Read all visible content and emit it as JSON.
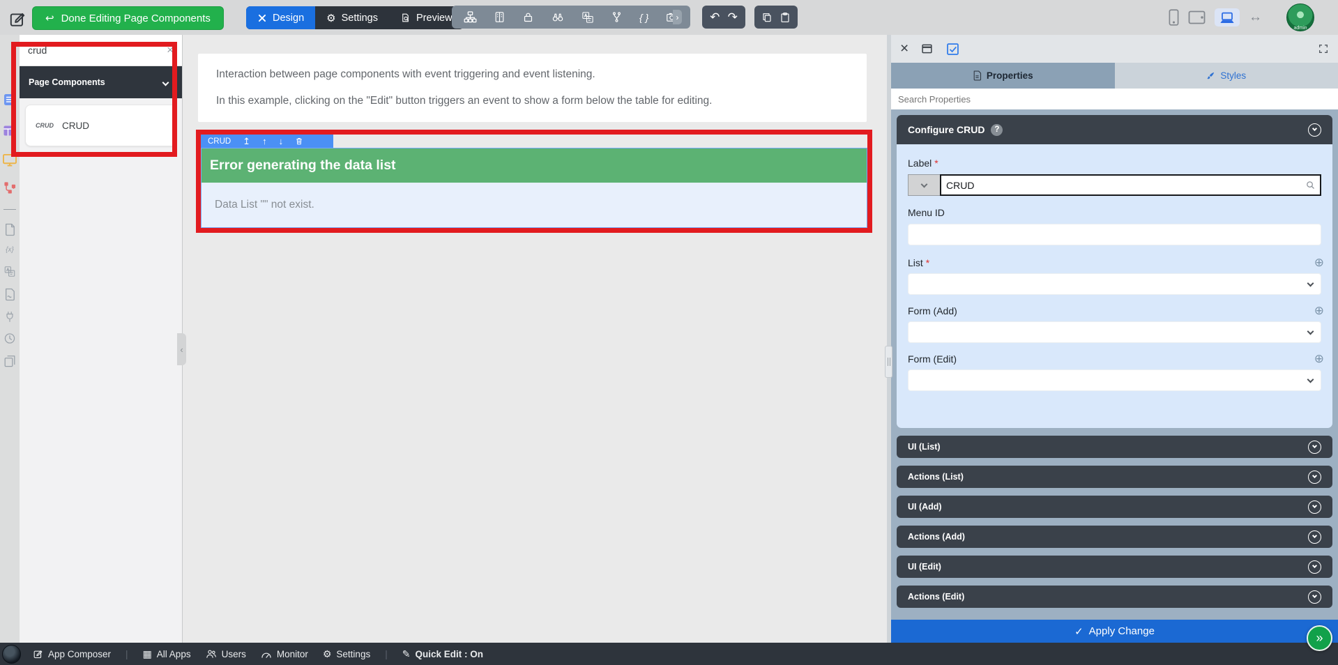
{
  "glyphs": {
    "back_arrow": "↩",
    "undo": "↶",
    "redo": "↷",
    "braces": "{ }",
    "chevron_right": "›",
    "arrows_lr": "↔",
    "gear": "⚙",
    "close": "×",
    "up_from_bar": "↥",
    "arrow_up": "↑",
    "arrow_down": "↓",
    "plus_circle": "⊕",
    "check": "✓",
    "double_right": "»",
    "grid": "▦",
    "pencil": "✎",
    "divider": "|",
    "collapse_left": "‹",
    "question": "?",
    "variable": "{x}"
  },
  "topbar": {
    "done_button_label": "Done Editing Page Components",
    "view_tabs": [
      {
        "label": "Design"
      },
      {
        "label": "Settings"
      },
      {
        "label": "Preview"
      }
    ],
    "tool_icons": [
      "sitemap",
      "form-builder",
      "lock",
      "binoculars",
      "translate",
      "branch",
      "braces",
      "camera"
    ],
    "history_icons": [
      "undo",
      "redo"
    ],
    "clipboard_icons": [
      "copy",
      "paste"
    ],
    "device_icons": [
      "mobile",
      "tablet",
      "desktop",
      "responsive"
    ],
    "avatar_label": "admin"
  },
  "left_strip": {
    "icons": [
      "compose",
      "form-blue",
      "datalist-purple",
      "userview-yellow",
      "process-red",
      "page",
      "variable",
      "translate",
      "script-file",
      "plugin",
      "history",
      "pages"
    ]
  },
  "sidebar": {
    "search_value": "crud",
    "section_label": "Page Components",
    "item": {
      "icon_text": "CRUD",
      "label": "CRUD"
    }
  },
  "canvas": {
    "intro_line1": "Interaction between page components with event triggering and event listening.",
    "intro_line2": "In this example, clicking on the \"Edit\" button triggers an event to show a form below the table for editing.",
    "crud": {
      "tag_label": "CRUD",
      "error_title": "Error generating the data list",
      "error_message": "Data List \"\" not exist."
    }
  },
  "panel": {
    "tabs": [
      {
        "label": "Properties"
      },
      {
        "label": "Styles"
      }
    ],
    "search_placeholder": "Search Properties",
    "required_marker": "*",
    "configure": {
      "title": "Configure CRUD",
      "fields": [
        {
          "label": "Label",
          "required": true,
          "value": "CRUD"
        },
        {
          "label": "Menu ID",
          "value": ""
        },
        {
          "label": "List",
          "required": true
        },
        {
          "label": "Form (Add)"
        },
        {
          "label": "Form (Edit)"
        }
      ]
    },
    "sections": [
      {
        "label": "UI (List)"
      },
      {
        "label": "Actions (List)"
      },
      {
        "label": "UI (Add)"
      },
      {
        "label": "Actions (Add)"
      },
      {
        "label": "UI (Edit)"
      },
      {
        "label": "Actions (Edit)"
      }
    ],
    "apply_button_label": "Apply Change"
  },
  "bottombar": {
    "items": [
      {
        "label": "App Composer",
        "icon": "compose"
      },
      {
        "label": "All Apps",
        "icon": "grid"
      },
      {
        "label": "Users",
        "icon": "users"
      },
      {
        "label": "Monitor",
        "icon": "gauge"
      },
      {
        "label": "Settings",
        "icon": "gear"
      },
      {
        "label": "Quick Edit : On",
        "icon": "pencil"
      }
    ]
  },
  "colors": {
    "annotation_red": "#e21b1f",
    "header_green": "#5cb273",
    "button_green": "#22b14c",
    "accent_blue": "#1a6fe0",
    "component_tab_blue": "#4b90f5",
    "apply_blue": "#1b69d3",
    "dark_bar": "#2e343c",
    "panel_body": "#9db0c2",
    "section_dark": "#3a414a",
    "card_light_blue": "#d9e8fb"
  }
}
